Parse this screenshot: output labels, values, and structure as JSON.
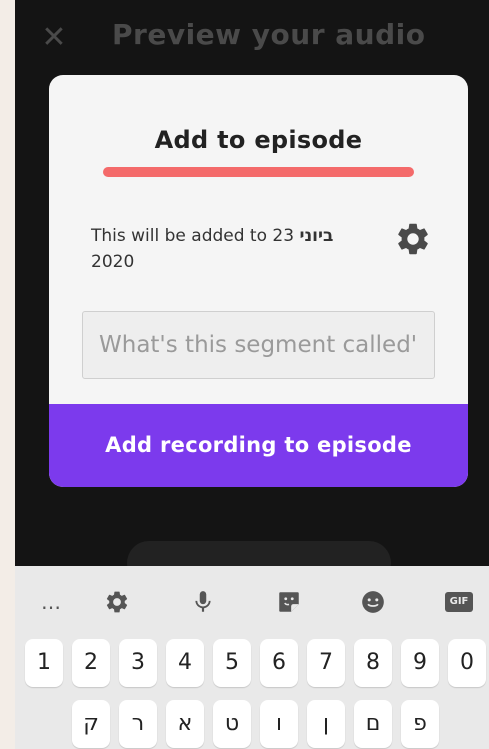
{
  "header": {
    "close_glyph": "✕",
    "title": "Preview your audio"
  },
  "modal": {
    "title": "Add to episode",
    "accent_color": "#f46a6a",
    "info_prefix": "This will be added to 23 ",
    "info_month": "ביוני",
    "info_year": "2020",
    "segment_placeholder": "What's this segment called'",
    "cta_label": "Add recording to episode",
    "cta_color": "#7c3aed"
  },
  "keyboard": {
    "toolbar": {
      "more": "…",
      "gif": "GIF"
    },
    "number_row": [
      "1",
      "2",
      "3",
      "4",
      "5",
      "6",
      "7",
      "8",
      "9",
      "0"
    ],
    "letter_row": [
      "ק",
      "ר",
      "א",
      "ט",
      "ו",
      "ן",
      "ם",
      "פ"
    ]
  }
}
